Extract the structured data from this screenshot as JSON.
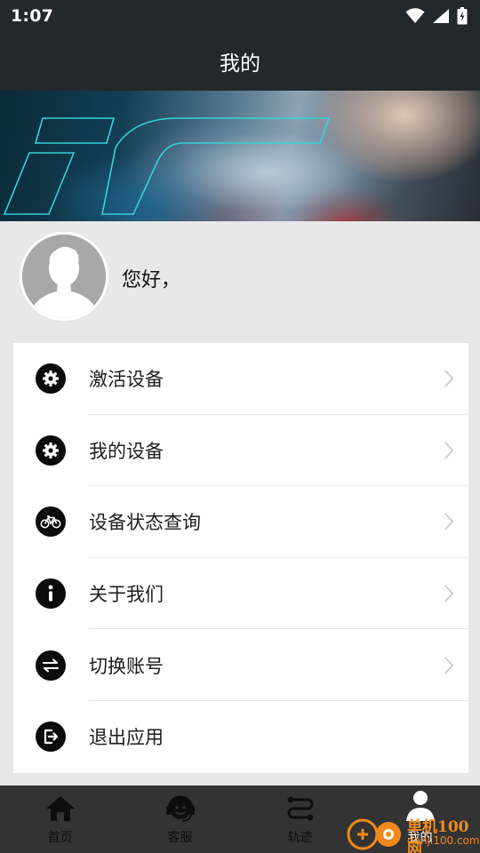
{
  "status_bar": {
    "time": "1:07"
  },
  "header": {
    "title": "我的"
  },
  "profile": {
    "greeting": "您好，"
  },
  "menu": {
    "items": [
      {
        "label": "激活设备",
        "icon": "gear-icon",
        "has_chevron": true
      },
      {
        "label": "我的设备",
        "icon": "gear-icon",
        "has_chevron": true
      },
      {
        "label": "设备状态查询",
        "icon": "bicycle-icon",
        "has_chevron": true
      },
      {
        "label": "关于我们",
        "icon": "info-icon",
        "has_chevron": true
      },
      {
        "label": "切换账号",
        "icon": "swap-icon",
        "has_chevron": true
      },
      {
        "label": "退出应用",
        "icon": "exit-icon",
        "has_chevron": false
      }
    ]
  },
  "tabbar": {
    "tabs": [
      {
        "label": "首页",
        "icon": "home-icon",
        "active": false
      },
      {
        "label": "客服",
        "icon": "headset-icon",
        "active": false
      },
      {
        "label": "轨迹",
        "icon": "route-icon",
        "active": false
      },
      {
        "label": "我的",
        "icon": "person-icon",
        "active": true
      }
    ]
  },
  "watermark": {
    "text_top": "单机100网",
    "text_bottom": "danji100.com"
  },
  "colors": {
    "header_bg": "#22292b",
    "page_bg": "#e8e8e8",
    "card_bg": "#ffffff",
    "tabbar_bg": "#333333",
    "icon_bg": "#0b0b0b",
    "watermark": "#f08a1a"
  }
}
